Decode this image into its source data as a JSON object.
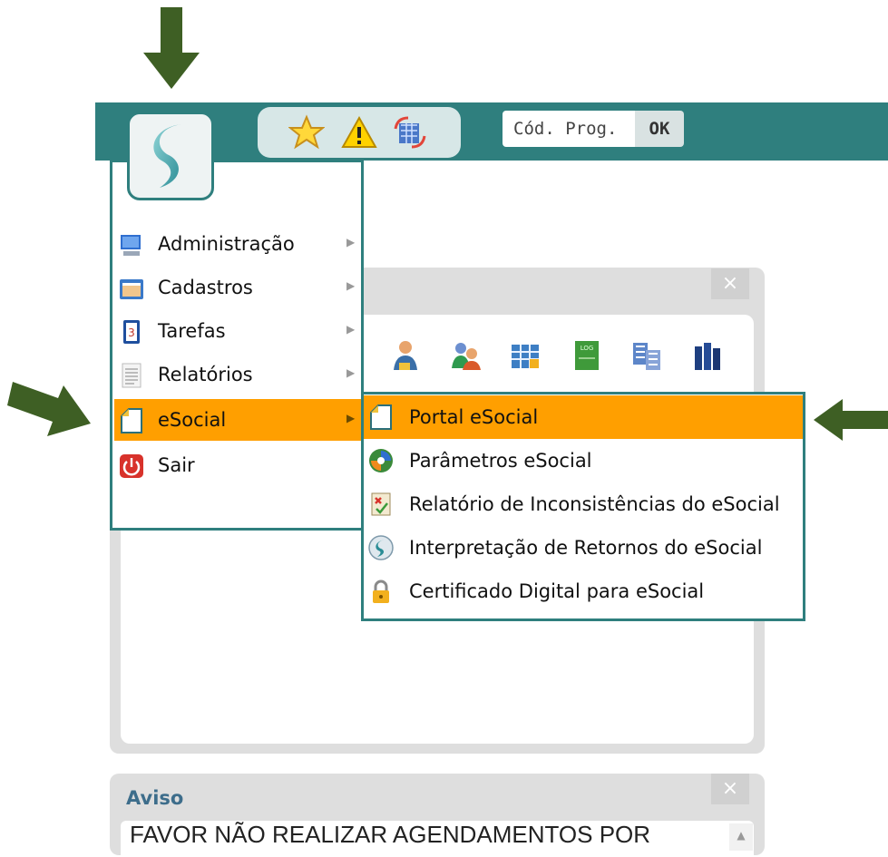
{
  "header": {
    "program_code_placeholder": "Cód. Prog.",
    "ok_label": "OK",
    "quick_icons": [
      "star-icon",
      "warning-icon",
      "refresh-grid-icon"
    ]
  },
  "main_menu": {
    "items": [
      {
        "label": "Administração",
        "icon": "monitor-icon",
        "has_submenu": true
      },
      {
        "label": "Cadastros",
        "icon": "folder-card-icon",
        "has_submenu": true
      },
      {
        "label": "Tarefas",
        "icon": "task-list-icon",
        "has_submenu": true
      },
      {
        "label": "Relatórios",
        "icon": "report-icon",
        "has_submenu": true
      },
      {
        "label": "eSocial",
        "icon": "esocial-page-icon",
        "has_submenu": true,
        "active": true
      },
      {
        "label": "Sair",
        "icon": "power-icon",
        "has_submenu": false
      }
    ]
  },
  "esocial_submenu": {
    "items": [
      {
        "label": "Portal eSocial",
        "icon": "esocial-page-icon",
        "active": true
      },
      {
        "label": "Parâmetros eSocial",
        "icon": "gear-cycle-icon"
      },
      {
        "label": "Relatório de Inconsistências do eSocial",
        "icon": "inconsistency-report-icon"
      },
      {
        "label": "Interpretação de Retornos do eSocial",
        "icon": "s-logo-icon"
      },
      {
        "label": "Certificado Digital para eSocial",
        "icon": "lock-icon"
      }
    ]
  },
  "aviso_panel": {
    "title": "Aviso",
    "text": "FAVOR NÃO REALIZAR AGENDAMENTOS POR"
  },
  "colors": {
    "topbar": "#2f7f7e",
    "menu_active": "#ff9f00",
    "annotation_arrow": "#3e5f24"
  }
}
